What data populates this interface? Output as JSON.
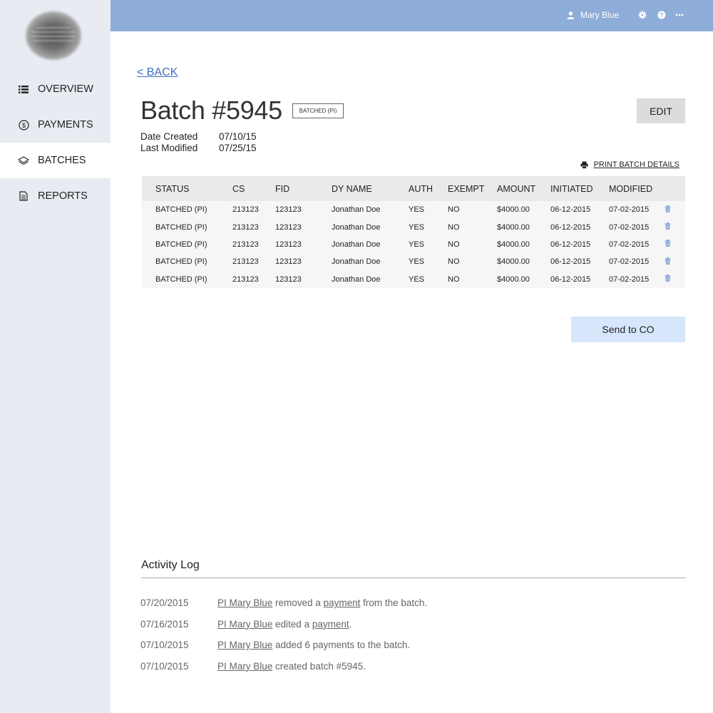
{
  "header": {
    "user_name": "Mary Blue",
    "icons": [
      "user-icon",
      "gear-icon",
      "help-icon",
      "more-icon"
    ]
  },
  "sidebar": {
    "items": [
      {
        "label": "OVERVIEW",
        "icon": "list-icon",
        "active": false
      },
      {
        "label": "PAYMENTS",
        "icon": "dollar-circle-icon",
        "active": false
      },
      {
        "label": "BATCHES",
        "icon": "layers-icon",
        "active": true
      },
      {
        "label": "REPORTS",
        "icon": "document-icon",
        "active": false
      }
    ]
  },
  "page": {
    "back_label": "< BACK",
    "title": "Batch #5945",
    "status_badge": "BATCHED (PI)",
    "edit_label": "EDIT",
    "meta": {
      "date_created_label": "Date Created",
      "date_created": "07/10/15",
      "last_modified_label": "Last Modified",
      "last_modified": "07/25/15"
    },
    "print_label": "PRINT BATCH DETAILS",
    "send_label": "Send to CO"
  },
  "table": {
    "columns": [
      "STATUS",
      "CS",
      "FID",
      "DY NAME",
      "AUTH",
      "EXEMPT",
      "AMOUNT",
      "INITIATED",
      "MODIFIED"
    ],
    "rows": [
      [
        "BATCHED (PI)",
        "213123",
        "123123",
        "Jonathan Doe",
        "YES",
        "NO",
        "$4000.00",
        "06-12-2015",
        "07-02-2015"
      ],
      [
        "BATCHED (PI)",
        "213123",
        "123123",
        "Jonathan Doe",
        "YES",
        "NO",
        "$4000.00",
        "06-12-2015",
        "07-02-2015"
      ],
      [
        "BATCHED (PI)",
        "213123",
        "123123",
        "Jonathan Doe",
        "YES",
        "NO",
        "$4000.00",
        "06-12-2015",
        "07-02-2015"
      ],
      [
        "BATCHED (PI)",
        "213123",
        "123123",
        "Jonathan Doe",
        "YES",
        "NO",
        "$4000.00",
        "06-12-2015",
        "07-02-2015"
      ],
      [
        "BATCHED (PI)",
        "213123",
        "123123",
        "Jonathan Doe",
        "YES",
        "NO",
        "$4000.00",
        "06-12-2015",
        "07-02-2015"
      ]
    ]
  },
  "activity_log": {
    "title": "Activity Log",
    "entries": [
      {
        "date": "07/20/2015",
        "actor": "PI Mary Blue",
        "pre": " removed a ",
        "link": "payment",
        "post": " from the batch."
      },
      {
        "date": "07/16/2015",
        "actor": "PI Mary Blue",
        "pre": " edited a ",
        "link": "payment",
        "post": "."
      },
      {
        "date": "07/10/2015",
        "actor": "PI Mary Blue",
        "pre": " added 6 payments to the batch.",
        "link": "",
        "post": ""
      },
      {
        "date": "07/10/2015",
        "actor": "PI Mary Blue",
        "pre": " created batch #5945.",
        "link": "",
        "post": ""
      }
    ]
  },
  "colors": {
    "topbar": "#8fadd9",
    "sidebar": "#e8ebf1",
    "send_button": "#d6e6fb",
    "link": "#3b6fc4",
    "trash_icon": "#7fa3d9"
  }
}
